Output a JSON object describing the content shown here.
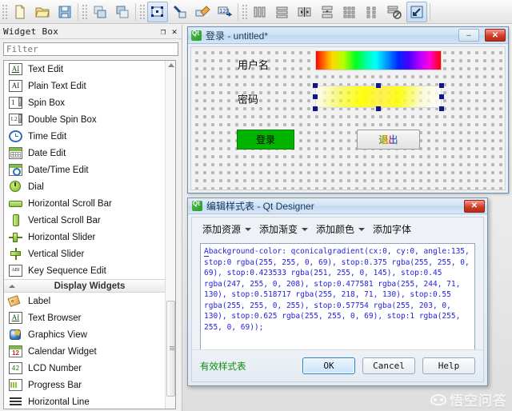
{
  "toolbar": {
    "groups": [
      {
        "buttons": [
          {
            "name": "new-form-icon",
            "label": "New"
          },
          {
            "name": "open-form-icon",
            "label": "Open"
          },
          {
            "name": "save-form-icon",
            "label": "Save"
          }
        ]
      },
      {
        "buttons": [
          {
            "name": "undo-icon",
            "label": "Undo"
          },
          {
            "name": "redo-icon",
            "label": "Redo"
          }
        ]
      },
      {
        "buttons": [
          {
            "name": "edit-widgets-icon",
            "label": "Edit Widgets",
            "active": true
          },
          {
            "name": "edit-signals-slots-icon",
            "label": "Edit Signals/Slots"
          },
          {
            "name": "edit-buddies-icon",
            "label": "Edit Buddies"
          },
          {
            "name": "edit-tab-order-icon",
            "label": "Edit Tab Order"
          }
        ]
      },
      {
        "buttons": [
          {
            "name": "layout-horizontally-icon",
            "label": "Lay Out Horizontally"
          },
          {
            "name": "layout-vertically-icon",
            "label": "Lay Out Vertically"
          },
          {
            "name": "layout-splitter-horizontal-icon",
            "label": "Lay Out Horizontally in Splitter"
          },
          {
            "name": "layout-splitter-vertical-icon",
            "label": "Lay Out Vertically in Splitter"
          },
          {
            "name": "layout-grid-icon",
            "label": "Lay Out in a Grid"
          },
          {
            "name": "layout-form-icon",
            "label": "Lay Out in a Form Layout"
          },
          {
            "name": "break-layout-icon",
            "label": "Break Layout"
          },
          {
            "name": "adjust-size-icon",
            "label": "Adjust Size",
            "active": true
          }
        ]
      }
    ]
  },
  "widget_box": {
    "title": "Widget Box",
    "undock_label": "❐",
    "close_label": "✕",
    "filter_placeholder": "Filter",
    "filter_value": "",
    "items": [
      {
        "label": "Text Edit",
        "icon": "text-edit-icon"
      },
      {
        "label": "Plain Text Edit",
        "icon": "plain-text-edit-icon"
      },
      {
        "label": "Spin Box",
        "icon": "spin-box-icon"
      },
      {
        "label": "Double Spin Box",
        "icon": "double-spin-box-icon"
      },
      {
        "label": "Time Edit",
        "icon": "time-edit-icon"
      },
      {
        "label": "Date Edit",
        "icon": "date-edit-icon"
      },
      {
        "label": "Date/Time Edit",
        "icon": "date-time-edit-icon"
      },
      {
        "label": "Dial",
        "icon": "dial-icon"
      },
      {
        "label": "Horizontal Scroll Bar",
        "icon": "horizontal-scroll-bar-icon"
      },
      {
        "label": "Vertical Scroll Bar",
        "icon": "vertical-scroll-bar-icon"
      },
      {
        "label": "Horizontal Slider",
        "icon": "horizontal-slider-icon"
      },
      {
        "label": "Vertical Slider",
        "icon": "vertical-slider-icon"
      },
      {
        "label": "Key Sequence Edit",
        "icon": "key-sequence-edit-icon"
      }
    ],
    "group_label": "Display Widgets",
    "display_items": [
      {
        "label": "Label",
        "icon": "label-icon"
      },
      {
        "label": "Text Browser",
        "icon": "text-browser-icon"
      },
      {
        "label": "Graphics View",
        "icon": "graphics-view-icon"
      },
      {
        "label": "Calendar Widget",
        "icon": "calendar-widget-icon"
      },
      {
        "label": "LCD Number",
        "icon": "lcd-number-icon"
      },
      {
        "label": "Progress Bar",
        "icon": "progress-bar-icon"
      },
      {
        "label": "Horizontal Line",
        "icon": "horizontal-line-icon"
      }
    ]
  },
  "form_window": {
    "title": "登录 - untitled*",
    "minimize_label": "–",
    "close_label": "✕",
    "labels": {
      "username": "用户名",
      "password": "密码"
    },
    "buttons": {
      "login": "登录",
      "exit": "退出"
    },
    "selected_widget": "password-field"
  },
  "stylesheet_dialog": {
    "title": "编辑样式表 - Qt Designer",
    "close_label": "✕",
    "toolbar": [
      {
        "label": "添加资源",
        "has_arrow": true
      },
      {
        "label": "添加渐变",
        "has_arrow": true
      },
      {
        "label": "添加颜色",
        "has_arrow": true
      },
      {
        "label": "添加字体",
        "has_arrow": false
      }
    ],
    "code": "background-color: qconicalgradient(cx:0, cy:0, angle:135, stop:0 rgba(255, 255, 0, 69), stop:0.375 rgba(255, 255, 0, 69), stop:0.423533 rgba(251, 255, 0, 145), stop:0.45 rgba(247, 255, 0, 208), stop:0.477581 rgba(255, 244, 71, 130), stop:0.518717 rgba(255, 218, 71, 130), stop:0.55 rgba(255, 255, 0, 255), stop:0.57754 rgba(255, 203, 0, 130), stop:0.625 rgba(255, 255, 0, 69), stop:1 rgba(255, 255, 0, 69));",
    "validity_text": "有效样式表",
    "validity_color": "#0a8f0a",
    "buttons": {
      "ok": "OK",
      "cancel": "Cancel",
      "help": "Help"
    }
  },
  "watermark": {
    "text": "悟空问答"
  }
}
